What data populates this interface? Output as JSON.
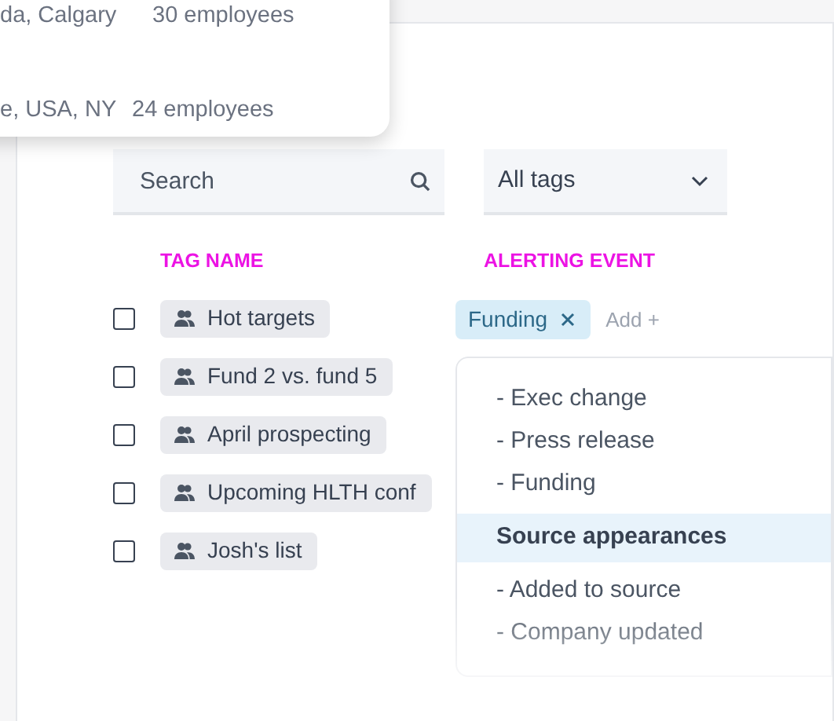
{
  "popup": {
    "rows": [
      {
        "location": "da, Calgary",
        "employees": "30 employees"
      },
      {
        "location": "e, USA, NY",
        "employees": "24 employees"
      }
    ]
  },
  "search": {
    "placeholder": "Search"
  },
  "filter": {
    "value": "All tags"
  },
  "columns": [
    "TAG NAME",
    "ALERTING EVENT"
  ],
  "tags": [
    {
      "name": "Hot targets",
      "checked": false
    },
    {
      "name": "Fund 2 vs. fund 5",
      "checked": false
    },
    {
      "name": "April prospecting",
      "checked": false
    },
    {
      "name": "Upcoming HLTH conf",
      "checked": false
    },
    {
      "name": "Josh's list",
      "checked": false
    }
  ],
  "event_chips": [
    {
      "label": "Funding"
    }
  ],
  "add_link": "Add +",
  "menu": [
    {
      "label": "- Exec change",
      "kind": "option",
      "selected": false
    },
    {
      "label": "- Press release",
      "kind": "option",
      "selected": false
    },
    {
      "label": "- Funding",
      "kind": "option",
      "selected": false
    },
    {
      "label": "Source appearances",
      "kind": "group",
      "selected": true
    },
    {
      "label": "- Added to source",
      "kind": "option",
      "selected": false
    },
    {
      "label": "- Company updated",
      "kind": "option",
      "selected": false
    }
  ]
}
